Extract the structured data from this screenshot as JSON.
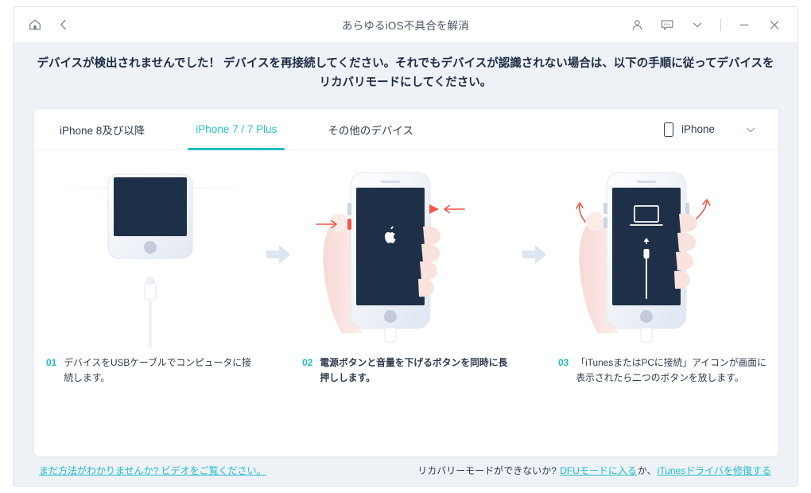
{
  "titlebar": {
    "home_icon": "home-icon",
    "back_icon": "back-arrow-icon",
    "title": "あらゆるiOS不具合を解消",
    "account_icon": "user-icon",
    "feedback_icon": "message-icon",
    "more_icon": "chevron-down-icon",
    "minimize_icon": "minimize-icon",
    "close_icon": "close-icon"
  },
  "banner": {
    "message": "デバイスが検出されませんでした！ デバイスを再接続してください。それでもデバイスが認識されない場合は、以下の手順に従ってデバイスをリカバリモードにしてください。"
  },
  "tabs": [
    {
      "label": "iPhone 8及び以降",
      "active": false
    },
    {
      "label": "iPhone 7 / 7 Plus",
      "active": true
    },
    {
      "label": "その他のデバイス",
      "active": false
    }
  ],
  "device_select": {
    "icon": "phone-icon",
    "value": "iPhone",
    "chevron": "chevron-down-icon"
  },
  "steps": [
    {
      "num": "01",
      "text": "デバイスをUSBケーブルでコンピュータに接続します。",
      "bold": false,
      "art": "phone-with-cable"
    },
    {
      "num": "02",
      "text": "電源ボタンと音量を下げるボタンを同時に長押しします。",
      "bold": true,
      "art": "hand-holding-phone-apple-logo"
    },
    {
      "num": "03",
      "text": "「iTunesまたはPCに接続」アイコンが画面に表示されたら二つのボタンを放します。",
      "bold": false,
      "art": "hand-holding-phone-connect-itunes"
    }
  ],
  "footer": {
    "video_link": "まだ方法がわかりませんか? ビデオをご覧ください。",
    "recovery_question": "リカバリーモードができないか?",
    "dfu_link": "DFUモードに入る",
    "conjunction": "か、",
    "driver_link": "iTunesドライバを修復する"
  },
  "colors": {
    "accent": "#21bcca",
    "screen_dark": "#1e3047",
    "body_bg": "#eef2f7",
    "arrow_gray": "#dde5f0",
    "red_arrow": "#f4564a"
  }
}
